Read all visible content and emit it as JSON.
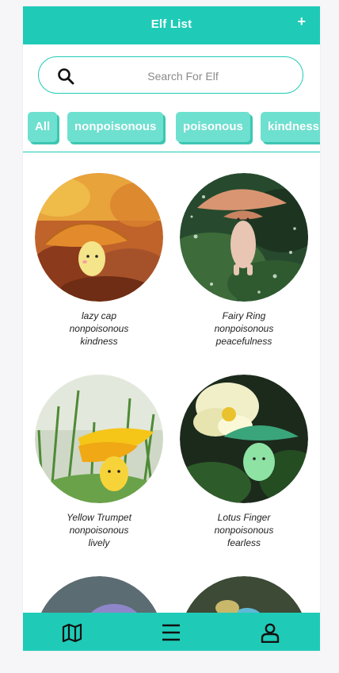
{
  "header": {
    "title": "Elf List",
    "add_label": "+"
  },
  "search": {
    "placeholder": "Search For Elf",
    "value": ""
  },
  "filters": [
    {
      "label": "All",
      "active": true
    },
    {
      "label": "nonpoisonous"
    },
    {
      "label": "poisonous"
    },
    {
      "label": "kindness"
    }
  ],
  "elves": [
    {
      "name": "lazy cap",
      "type": "nonpoisonous",
      "trait": "kindness"
    },
    {
      "name": "Fairy Ring",
      "type": "nonpoisonous",
      "trait": "peacefulness"
    },
    {
      "name": "Yellow Trumpet",
      "type": "nonpoisonous",
      "trait": "lively"
    },
    {
      "name": "Lotus Finger",
      "type": "nonpoisonous",
      "trait": "fearless"
    }
  ],
  "footer": {
    "items": [
      "map-icon",
      "menu-icon",
      "profile-icon"
    ]
  },
  "colors": {
    "accent": "#1fcbb7",
    "tag": "#6ee0d0",
    "tag_shadow": "#3ec6b2"
  }
}
